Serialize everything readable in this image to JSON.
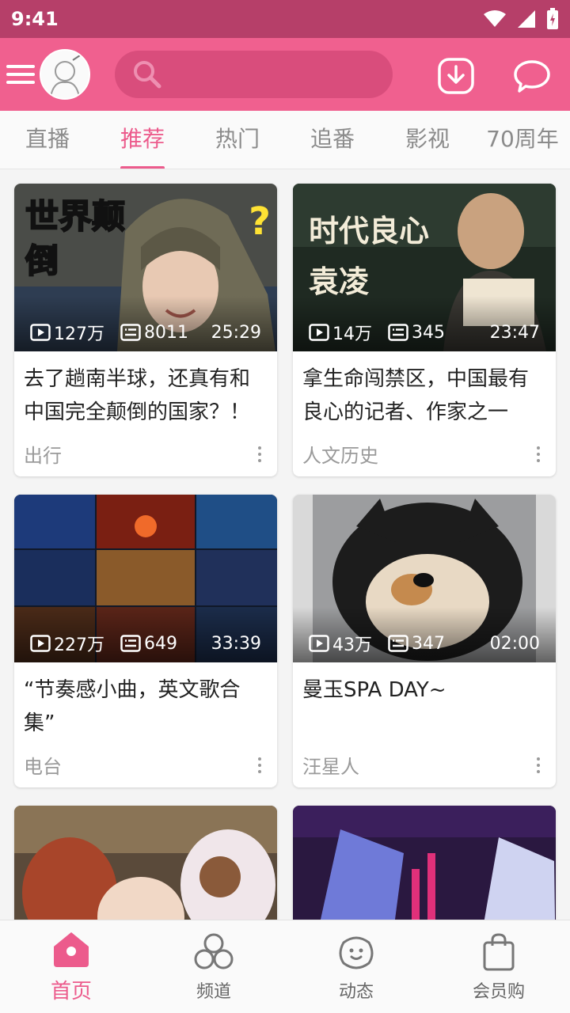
{
  "status_bar": {
    "time": "9:41"
  },
  "search": {
    "placeholder": ""
  },
  "tabs": [
    {
      "label": "直播",
      "active": false
    },
    {
      "label": "推荐",
      "active": true
    },
    {
      "label": "热门",
      "active": false
    },
    {
      "label": "追番",
      "active": false
    },
    {
      "label": "影视",
      "active": false
    },
    {
      "label": "70周年",
      "active": false
    }
  ],
  "cards": [
    {
      "thumb_text": "世界颠倒",
      "views": "127万",
      "danmaku": "8011",
      "duration": "25:29",
      "title": "去了趟南半球，还真有和中国完全颠倒的国家？！",
      "tag": "出行"
    },
    {
      "thumb_text": "时代良心 袁凌",
      "views": "14万",
      "danmaku": "345",
      "duration": "23:47",
      "title": "拿生命闯禁区，中国最有良心的记者、作家之一",
      "tag": "人文历史"
    },
    {
      "views": "227万",
      "danmaku": "649",
      "duration": "33:39",
      "title": "“节奏感小曲，英文歌合集”",
      "tag": "电台"
    },
    {
      "views": "43万",
      "danmaku": "347",
      "duration": "02:00",
      "title": "曼玉SPA DAY~",
      "tag": "汪星人"
    }
  ],
  "bottom_nav": [
    {
      "label": "首页",
      "icon": "home-icon",
      "active": true
    },
    {
      "label": "频道",
      "icon": "channels-icon",
      "active": false
    },
    {
      "label": "动态",
      "icon": "feed-icon",
      "active": false
    },
    {
      "label": "会员购",
      "icon": "shopping-bag-icon",
      "active": false
    }
  ],
  "colors": {
    "brand": "#f0608f",
    "status_bar": "#b63f69",
    "accent": "#ec5b8c"
  }
}
